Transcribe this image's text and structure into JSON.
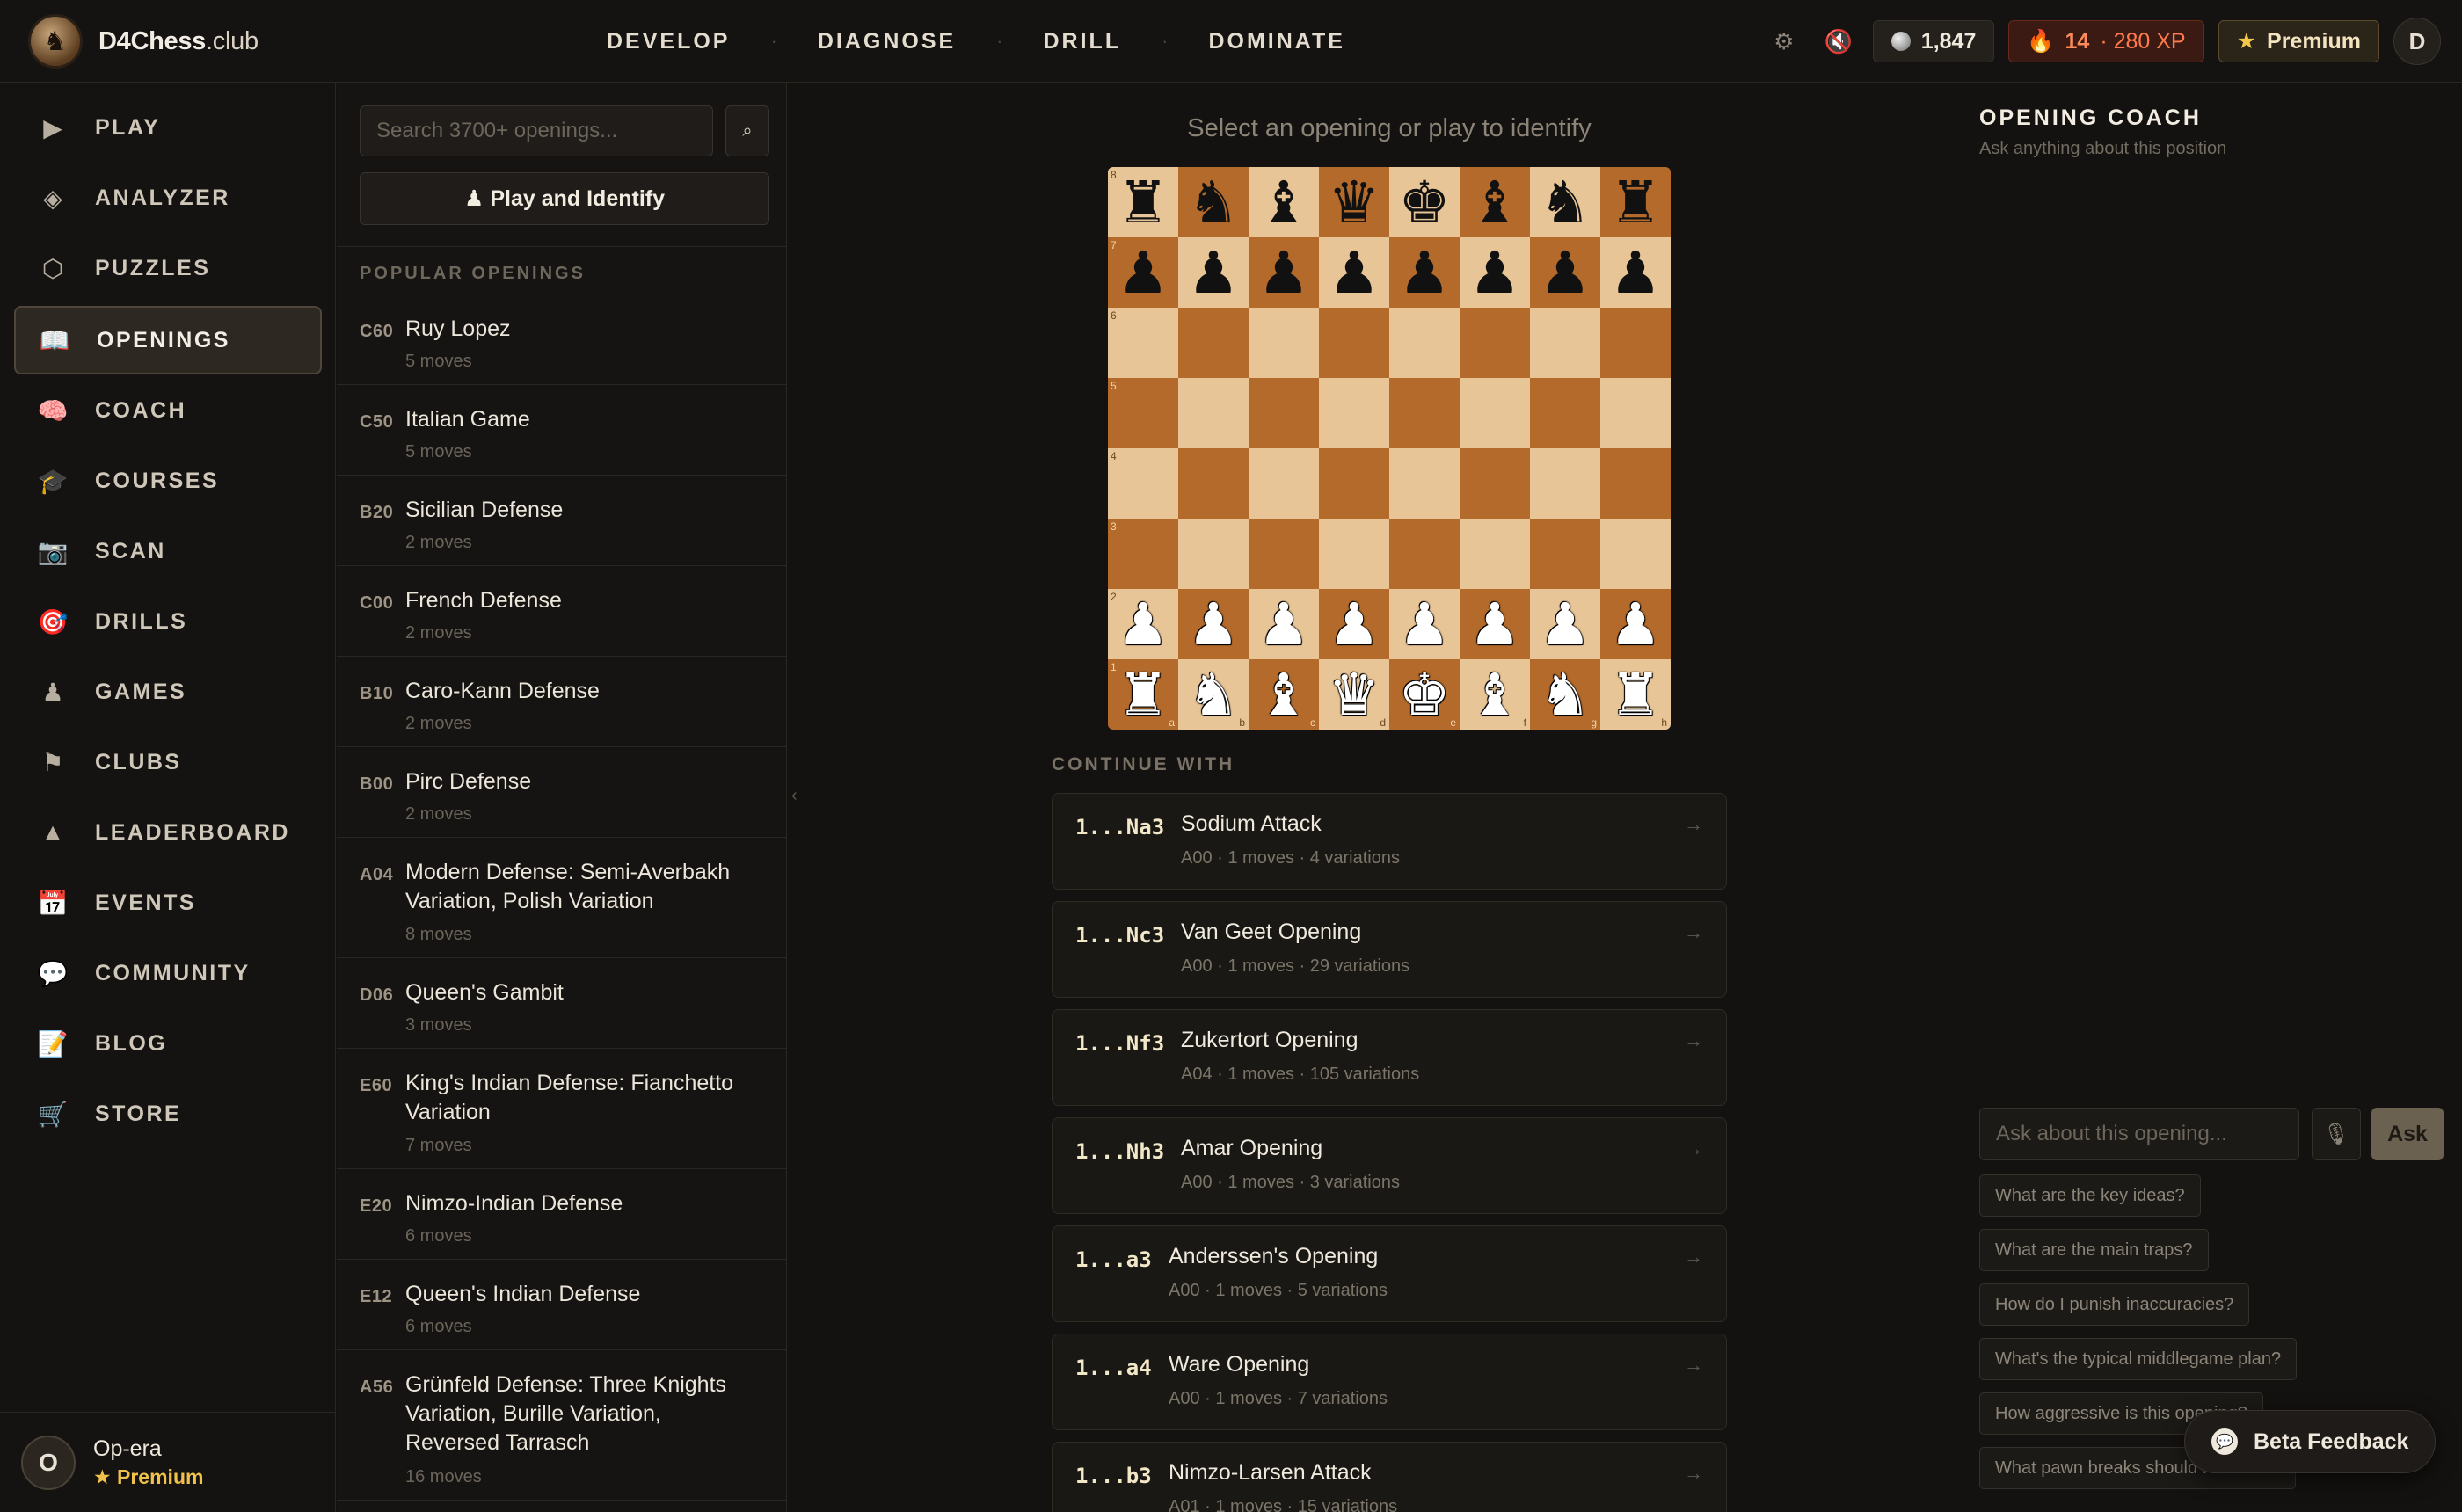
{
  "brand": {
    "name": "D4Chess",
    "suffix": ".club"
  },
  "topnav": [
    "DEVELOP",
    "DIAGNOSE",
    "DRILL",
    "DOMINATE"
  ],
  "topright": {
    "rating": "1,847",
    "streak": "14",
    "xp": "· 280 XP",
    "premium": "Premium",
    "avatar_initial": "D"
  },
  "sidebar": {
    "items": [
      {
        "label": "PLAY",
        "icon": "▶"
      },
      {
        "label": "ANALYZER",
        "icon": "◈"
      },
      {
        "label": "PUZZLES",
        "icon": "⬡"
      },
      {
        "label": "OPENINGS",
        "icon": "📖"
      },
      {
        "label": "COACH",
        "icon": "🧠"
      },
      {
        "label": "COURSES",
        "icon": "🎓"
      },
      {
        "label": "SCAN",
        "icon": "📷"
      },
      {
        "label": "DRILLS",
        "icon": "🎯"
      },
      {
        "label": "GAMES",
        "icon": "♟"
      },
      {
        "label": "CLUBS",
        "icon": "⚑"
      },
      {
        "label": "LEADERBOARD",
        "icon": "▲"
      },
      {
        "label": "EVENTS",
        "icon": "📅"
      },
      {
        "label": "COMMUNITY",
        "icon": "💬"
      },
      {
        "label": "BLOG",
        "icon": "📝"
      },
      {
        "label": "STORE",
        "icon": "🛒"
      }
    ],
    "active": "OPENINGS",
    "user": {
      "initial": "O",
      "name": "Op-era",
      "plan": "Premium"
    }
  },
  "openings": {
    "search_placeholder": "Search 3700+ openings...",
    "identify_label": "♟ Play and Identify",
    "popular_title": "POPULAR OPENINGS",
    "list": [
      {
        "eco": "C60",
        "name": "Ruy Lopez",
        "moves": "5 moves"
      },
      {
        "eco": "C50",
        "name": "Italian Game",
        "moves": "5 moves"
      },
      {
        "eco": "B20",
        "name": "Sicilian Defense",
        "moves": "2 moves"
      },
      {
        "eco": "C00",
        "name": "French Defense",
        "moves": "2 moves"
      },
      {
        "eco": "B10",
        "name": "Caro-Kann Defense",
        "moves": "2 moves"
      },
      {
        "eco": "B00",
        "name": "Pirc Defense",
        "moves": "2 moves"
      },
      {
        "eco": "A04",
        "name": "Modern Defense: Semi-Averbakh Variation, Polish Variation",
        "moves": "8 moves"
      },
      {
        "eco": "D06",
        "name": "Queen's Gambit",
        "moves": "3 moves"
      },
      {
        "eco": "E60",
        "name": "King's Indian Defense: Fianchetto Variation",
        "moves": "7 moves"
      },
      {
        "eco": "E20",
        "name": "Nimzo-Indian Defense",
        "moves": "6 moves"
      },
      {
        "eco": "E12",
        "name": "Queen's Indian Defense",
        "moves": "6 moves"
      },
      {
        "eco": "A56",
        "name": "Grünfeld Defense: Three Knights Variation, Burille Variation, Reversed Tarrasch",
        "moves": "16 moves"
      }
    ]
  },
  "board": {
    "caption": "Select an opening or play to identify",
    "files": [
      "a",
      "b",
      "c",
      "d",
      "e",
      "f",
      "g",
      "h"
    ],
    "ranks": [
      "8",
      "7",
      "6",
      "5",
      "4",
      "3",
      "2",
      "1"
    ],
    "position": [
      "rnbqkbnr",
      "pppppppp",
      "........",
      "........",
      "........",
      "........",
      "PPPPPPPP",
      "RNBQKBNR"
    ]
  },
  "continue": {
    "title": "CONTINUE WITH",
    "items": [
      {
        "move": "1...Na3",
        "name": "Sodium Attack",
        "meta": "A00 · 1 moves · 4 variations"
      },
      {
        "move": "1...Nc3",
        "name": "Van Geet Opening",
        "meta": "A00 · 1 moves · 29 variations"
      },
      {
        "move": "1...Nf3",
        "name": "Zukertort Opening",
        "meta": "A04 · 1 moves · 105 variations"
      },
      {
        "move": "1...Nh3",
        "name": "Amar Opening",
        "meta": "A00 · 1 moves · 3 variations"
      },
      {
        "move": "1...a3",
        "name": "Anderssen's Opening",
        "meta": "A00 · 1 moves · 5 variations"
      },
      {
        "move": "1...a4",
        "name": "Ware Opening",
        "meta": "A00 · 1 moves · 7 variations"
      },
      {
        "move": "1...b3",
        "name": "Nimzo-Larsen Attack",
        "meta": "A01 · 1 moves · 15 variations"
      }
    ]
  },
  "coach": {
    "title": "OPENING COACH",
    "subtitle": "Ask anything about this position",
    "input_placeholder": "Ask about this opening...",
    "ask_label": "Ask",
    "suggestions": [
      "What are the key ideas?",
      "What are the main traps?",
      "How do I punish inaccuracies?",
      "What's the typical middlegame plan?",
      "How aggressive is this opening?",
      "What pawn breaks should I look for?"
    ]
  },
  "feedback_label": "Beta Feedback"
}
